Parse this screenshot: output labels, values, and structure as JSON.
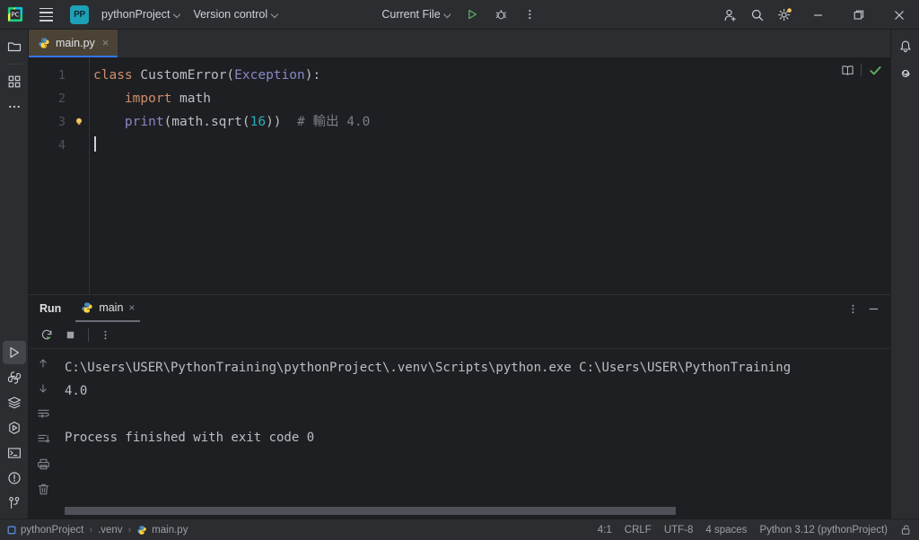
{
  "titlebar": {
    "app_icon": "pycharm-logo-icon",
    "menu_icon": "hamburger-menu-icon",
    "project_initials": "PP",
    "project_name": "pythonProject",
    "version_control": "Version control",
    "run_config": "Current File",
    "run_icon": "run-triangle-icon",
    "debug_icon": "debug-bug-icon",
    "more_icon": "more-vertical-icon",
    "account_icon": "add-user-icon",
    "search_icon": "search-icon",
    "settings_icon": "gear-icon",
    "minimize_icon": "minimize-icon",
    "maximize_icon": "maximize-restore-icon",
    "close_icon": "close-icon"
  },
  "left_strip": {
    "top": [
      {
        "name": "project-files-icon",
        "title": "Project"
      },
      {
        "name": "structure-icon",
        "title": "Structure"
      },
      {
        "name": "more-tool-windows-icon",
        "title": "More tool windows"
      }
    ],
    "bottom": [
      {
        "name": "run-tool-icon",
        "title": "Run",
        "active": true
      },
      {
        "name": "python-console-icon",
        "title": "Python Console"
      },
      {
        "name": "services-icon",
        "title": "Services"
      },
      {
        "name": "python-packages-icon",
        "title": "Python Packages"
      },
      {
        "name": "terminal-icon",
        "title": "Terminal"
      },
      {
        "name": "problems-icon",
        "title": "Problems"
      },
      {
        "name": "version-control-icon",
        "title": "Version Control"
      }
    ]
  },
  "right_strip": [
    {
      "name": "notifications-bell-icon",
      "title": "Notifications"
    },
    {
      "name": "ai-assistant-icon",
      "title": "AI Assistant"
    }
  ],
  "editor": {
    "tab": {
      "label": "main.py",
      "icon": "python-file-icon",
      "close": "×"
    },
    "reader_mode_icon": "book-reader-mode-icon",
    "inspection_status_icon": "green-check-inspections-icon",
    "line_numbers": [
      "1",
      "2",
      "3",
      "4"
    ],
    "gutter_bulb_line": 3,
    "lines": [
      {
        "n": "1",
        "tokens": [
          {
            "t": "class",
            "c": "kw"
          },
          {
            "t": " ",
            "c": "punct"
          },
          {
            "t": "CustomError",
            "c": "cls"
          },
          {
            "t": "(",
            "c": "punct"
          },
          {
            "t": "Exception",
            "c": "typ"
          },
          {
            "t": "):",
            "c": "punct"
          }
        ]
      },
      {
        "n": "2",
        "tokens": [
          {
            "t": "    ",
            "c": "punct"
          },
          {
            "t": "import",
            "c": "kw"
          },
          {
            "t": " math",
            "c": "cls"
          }
        ]
      },
      {
        "n": "3",
        "tokens": [
          {
            "t": "    ",
            "c": "punct"
          },
          {
            "t": "print",
            "c": "fn"
          },
          {
            "t": "(math.sqrt(",
            "c": "punct"
          },
          {
            "t": "16",
            "c": "num"
          },
          {
            "t": "))",
            "c": "punct"
          },
          {
            "t": "  # 輸出 4.0",
            "c": "cmt"
          }
        ]
      },
      {
        "n": "4",
        "tokens": []
      }
    ]
  },
  "run_panel": {
    "title": "Run",
    "tab": {
      "label": "main",
      "icon": "python-file-icon",
      "close": "×"
    },
    "rerun_icon": "rerun-icon",
    "stop_icon": "stop-square-icon",
    "more_icon": "more-vertical-icon",
    "hide_icon": "minimize-panel-icon",
    "options_icon": "more-vertical-icon",
    "side_tools": [
      {
        "name": "up-arrow-icon",
        "title": "Previous Occurrence"
      },
      {
        "name": "down-arrow-icon",
        "title": "Next Occurrence"
      },
      {
        "name": "soft-wrap-icon",
        "title": "Soft-Wrap"
      },
      {
        "name": "scroll-to-end-icon",
        "title": "Scroll to End"
      },
      {
        "name": "print-icon",
        "title": "Print"
      },
      {
        "name": "trash-icon",
        "title": "Clear All"
      }
    ],
    "console_lines": [
      "C:\\Users\\USER\\PythonTraining\\pythonProject\\.venv\\Scripts\\python.exe C:\\Users\\USER\\PythonTraining",
      "4.0",
      "",
      "Process finished with exit code 0"
    ]
  },
  "status_bar": {
    "breadcrumbs": [
      {
        "label": "pythonProject",
        "icon": "project-module-icon"
      },
      {
        "label": ".venv",
        "icon": ""
      },
      {
        "label": "main.py",
        "icon": "python-file-icon"
      }
    ],
    "separator": "›",
    "caret_position": "4:1",
    "line_separator": "CRLF",
    "encoding": "UTF-8",
    "indent": "4 spaces",
    "interpreter": "Python 3.12 (pythonProject)",
    "lock_icon": "unlocked-padlock-icon"
  },
  "colors": {
    "bg": "#1e1f22",
    "chrome": "#2b2d30",
    "accent": "#3574f0",
    "tab_active": "#4a4336",
    "keyword": "#cf8e6d",
    "type": "#8888c6",
    "number": "#2aacb8",
    "comment": "#7a7e85",
    "text": "#bcbec4"
  }
}
